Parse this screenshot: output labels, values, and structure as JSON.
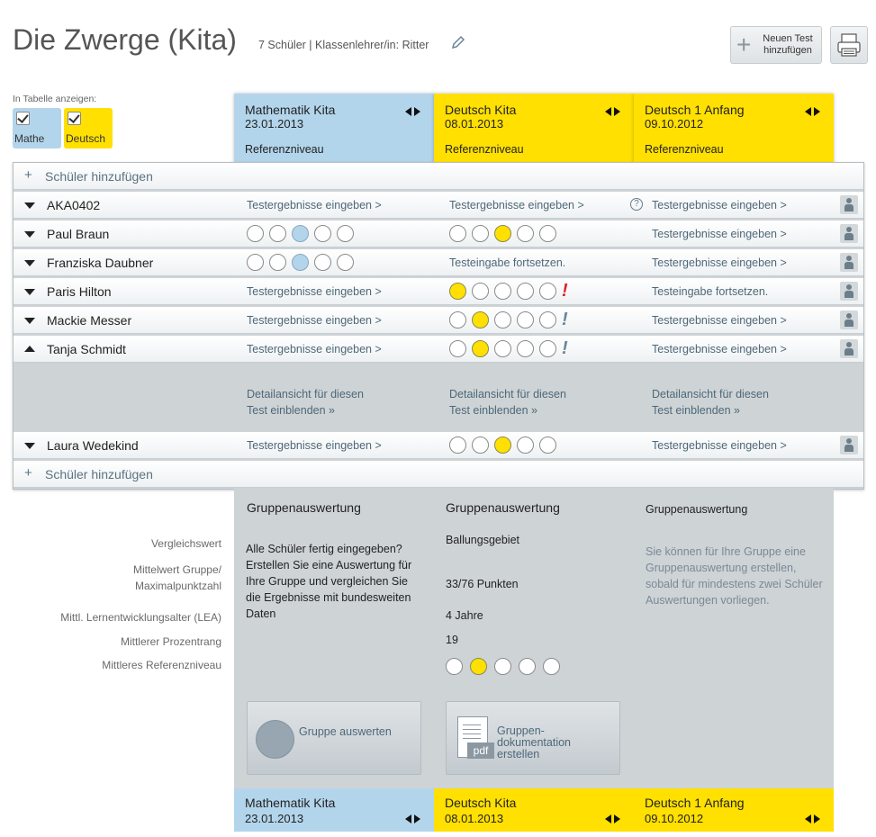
{
  "header": {
    "title": "Die Zwerge (Kita)",
    "subtitle": "7 Schüler | Klassenlehrer/in: Ritter",
    "new_test_label": "Neuen Test hinzufügen"
  },
  "filter": {
    "label": "In Tabelle anzeigen:",
    "options": [
      {
        "label": "Mathe",
        "checked": true,
        "color": "#b3d5ec"
      },
      {
        "label": "Deutsch",
        "checked": true,
        "color": "#ffe000"
      }
    ]
  },
  "tests": [
    {
      "name": "Mathematik Kita",
      "date": "23.01.2013",
      "level_label": "Referenzniveau",
      "color": "#b3d5ec"
    },
    {
      "name": "Deutsch Kita",
      "date": "08.01.2013",
      "level_label": "Referenzniveau",
      "color": "#ffe000"
    },
    {
      "name": "Deutsch 1 Anfang",
      "date": "09.10.2012",
      "level_label": "Referenzniveau",
      "color": "#ffe000"
    }
  ],
  "add_student_label": "Schüler hinzufügen",
  "links": {
    "enter_results": "Testergebnisse eingeben >",
    "continue_entry": "Testeingabe fortsetzen.",
    "detail_line1": "Detailansicht für diesen",
    "detail_line2": "Test einblenden »"
  },
  "students": [
    {
      "name": "AKA0402",
      "expanded": false
    },
    {
      "name": "Paul Braun",
      "expanded": false
    },
    {
      "name": "Franziska Daubner",
      "expanded": false
    },
    {
      "name": "Paris Hilton",
      "expanded": false
    },
    {
      "name": "Mackie Messer",
      "expanded": false
    },
    {
      "name": "Tanja Schmidt",
      "expanded": true
    },
    {
      "name": "Laura Wedekind",
      "expanded": false
    }
  ],
  "group": {
    "title": "Gruppenauswertung",
    "labels": {
      "vergleichswert": "Vergleichswert",
      "mittelwert_1": "Mittelwert Gruppe/",
      "mittelwert_2": "Maximalpunktzahl",
      "lea": "Mittl. Lernentwicklungsalter (LEA)",
      "prozentrang": "Mittlerer Prozentrang",
      "referenzniveau": "Mittleres Referenzniveau"
    },
    "col1_text": [
      "Alle Schüler fertig eingegeben?",
      "Erstellen Sie eine Auswertung für",
      "Ihre Gruppe und vergleichen Sie",
      "die Ergebnisse mit bundesweiten",
      "Daten"
    ],
    "col2": {
      "vergleichswert": "Ballungsgebiet",
      "mittelwert": "33/76 Punkten",
      "lea": "4 Jahre",
      "prozentrang": "19",
      "referenzniveau_level": 2
    },
    "col3_text": [
      "Sie können für Ihre Gruppe eine",
      "Gruppenauswertung erstellen,",
      "sobald für mindestens zwei Schüler",
      "Auswertungen vorliegen."
    ],
    "btn_evaluate": "Gruppe auswerten",
    "btn_pdf": [
      "Gruppen-",
      "dokumentation",
      "erstellen"
    ],
    "pdf_icon_label": "pdf"
  }
}
